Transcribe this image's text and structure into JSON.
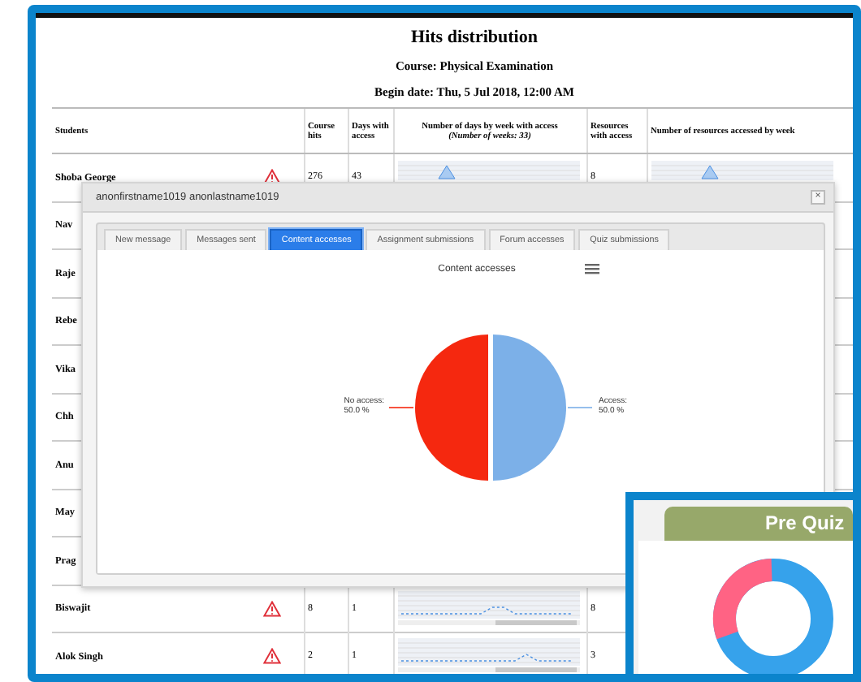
{
  "report": {
    "title": "Hits distribution",
    "course": "Course: Physical Examination",
    "begin_date": "Begin date: Thu, 5 Jul 2018, 12:00 AM"
  },
  "table": {
    "columns": [
      "Students",
      "Course hits",
      "Days with access",
      "Number of days by week with access",
      "Resources with access",
      "Number of resources accessed by week"
    ],
    "weeks_note": "(Number of weeks: 33)",
    "rows": [
      {
        "student": "Shoba George",
        "warning": true,
        "course_hits": "276",
        "days_with_access": "43",
        "resources_with_access": "8"
      },
      {
        "student": "Nav"
      },
      {
        "student": "Raje"
      },
      {
        "student": "Rebe"
      },
      {
        "student": "Vika"
      },
      {
        "student": "Chh"
      },
      {
        "student": "Anu"
      },
      {
        "student": "May"
      },
      {
        "student": "Prag"
      },
      {
        "student": "Biswajit",
        "warning": true,
        "course_hits": "8",
        "days_with_access": "1",
        "resources_with_access": "8"
      },
      {
        "student": "Alok Singh",
        "warning": true,
        "course_hits": "2",
        "days_with_access": "1",
        "resources_with_access": "3"
      }
    ]
  },
  "dialog": {
    "title": "anonfirstname1019 anonlastname1019",
    "close": "×",
    "tabs": [
      {
        "label": "New message",
        "selected": false
      },
      {
        "label": "Messages sent",
        "selected": false
      },
      {
        "label": "Content accesses",
        "selected": true
      },
      {
        "label": "Assignment submissions",
        "selected": false
      },
      {
        "label": "Forum accesses",
        "selected": false
      },
      {
        "label": "Quiz submissions",
        "selected": false
      }
    ],
    "chart_data": {
      "type": "pie",
      "title": "Content accesses",
      "series": [
        {
          "colors": [
            "#f5280f",
            "#7cb0e8"
          ],
          "values": [
            50,
            50
          ]
        }
      ],
      "value_labels": [
        "No access:\n50.0 %",
        "Access:\n50.0 %"
      ]
    }
  },
  "pre_quiz": {
    "title": "Pre Quiz"
  }
}
